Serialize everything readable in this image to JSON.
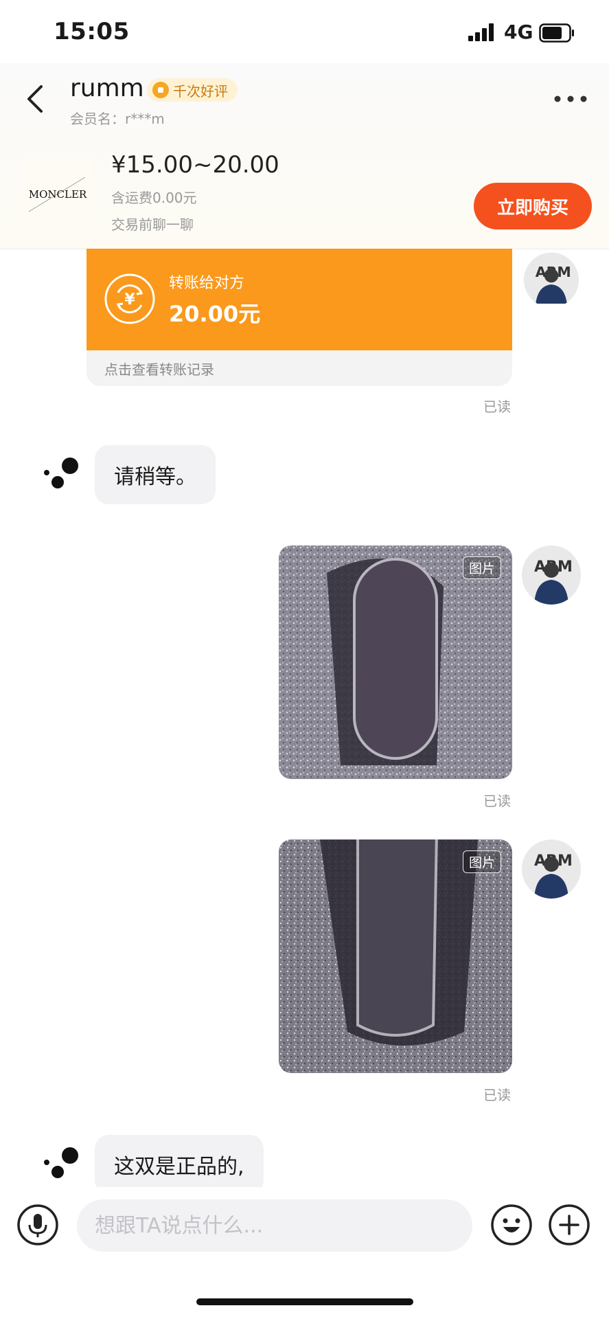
{
  "status_bar": {
    "time": "15:05",
    "network": "4G",
    "battery_level": 0.75
  },
  "header": {
    "seller_name": "rumm",
    "badge": "千次好评",
    "member_label": "会员名：",
    "member_name": "r***m"
  },
  "product": {
    "brand_logo_text": "MONCLER",
    "price": "¥15.00~20.00",
    "shipping": "含运费0.00元",
    "chat_hint": "交易前聊一聊",
    "buy_label": "立即购买"
  },
  "messages": {
    "transfer": {
      "title": "转账给对方",
      "amount": "20.00元",
      "view_record": "点击查看转账记录",
      "status": "已读"
    },
    "reply_1": "请稍等。",
    "image_1": {
      "tag": "图片",
      "status": "已读"
    },
    "image_2": {
      "tag": "图片",
      "status": "已读"
    },
    "reply_2": "这双是正品的,"
  },
  "input": {
    "placeholder": "想跟TA说点什么..."
  },
  "colors": {
    "accent_orange": "#fa991c",
    "buy_button": "#f4511e",
    "bubble_gray": "#f2f2f4"
  },
  "icons": [
    "back-icon",
    "more-icon",
    "transfer-yuan-icon",
    "bot-avatar-icon",
    "mic-icon",
    "emoji-icon",
    "plus-icon"
  ]
}
